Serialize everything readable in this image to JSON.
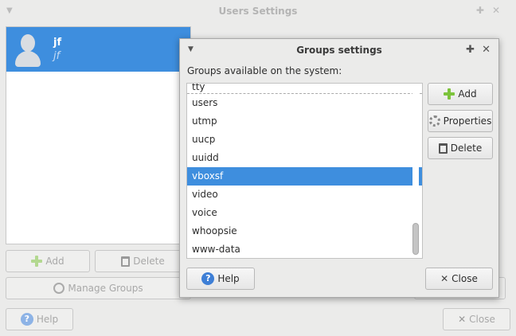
{
  "users_window": {
    "title": "Users Settings",
    "users": [
      {
        "name": "jf",
        "login": "jf"
      }
    ],
    "add_label": "Add",
    "delete_label": "Delete",
    "manage_groups_label": "Manage Groups",
    "help_label": "Help",
    "close_label": "Close"
  },
  "groups_dialog": {
    "title": "Groups settings",
    "list_label": "Groups available on the system:",
    "partial_item": "tty",
    "groups": [
      "users",
      "utmp",
      "uucp",
      "uuidd",
      "vboxsf",
      "video",
      "voice",
      "whoopsie",
      "www-data"
    ],
    "selected_group": "vboxsf",
    "add_label": "Add",
    "properties_label": "Properties",
    "delete_label": "Delete",
    "help_label": "Help",
    "close_label": "Close"
  },
  "icons": {
    "pin": "pin-icon",
    "close": "close-icon",
    "menu": "window-menu-icon"
  },
  "colors": {
    "selection": "#3e8ede",
    "add_icon": "#7cc33c",
    "help_icon": "#3e7fd6"
  }
}
